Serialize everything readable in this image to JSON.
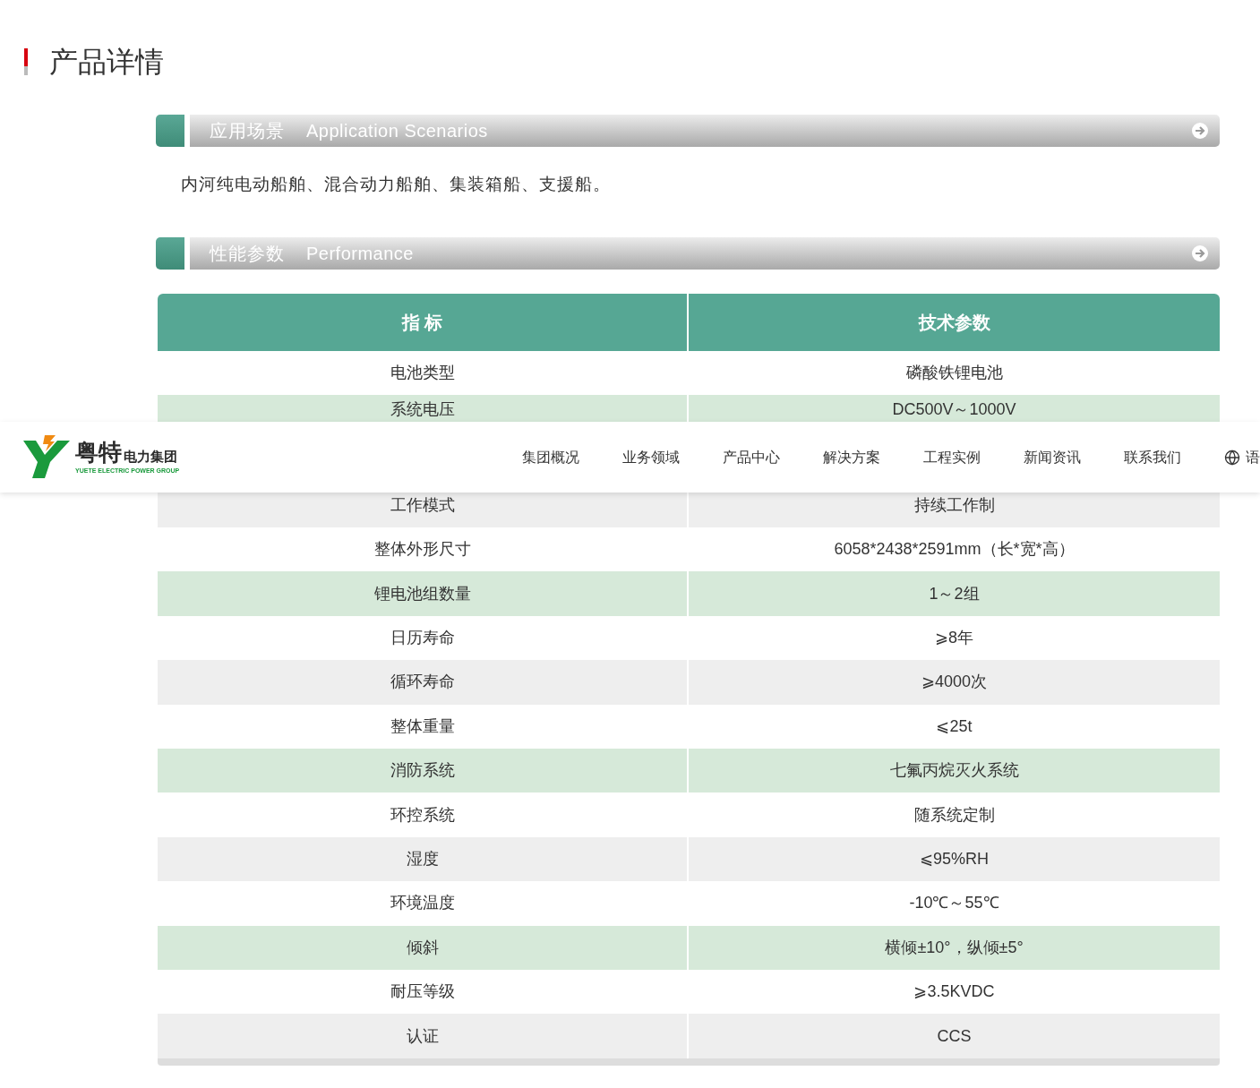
{
  "page_title": "产品详情",
  "sections": [
    {
      "title_cn": "应用场景",
      "title_en": "Application Scenarios",
      "text": "内河纯电动船舶、混合动力船舶、集装箱船、支援船。"
    },
    {
      "title_cn": "性能参数",
      "title_en": "Performance"
    }
  ],
  "table": {
    "columns": [
      "指 标",
      "技术参数"
    ],
    "rows": [
      [
        "电池类型",
        "磷酸铁锂电池"
      ],
      [
        "系统电压",
        "DC500V～1000V"
      ],
      [
        "工作模式",
        "持续工作制"
      ],
      [
        "整体外形尺寸",
        "6058*2438*2591mm（长*宽*高）"
      ],
      [
        "锂电池组数量",
        "1～2组"
      ],
      [
        "日历寿命",
        "⩾8年"
      ],
      [
        "循环寿命",
        "⩾4000次"
      ],
      [
        "整体重量",
        "⩽25t"
      ],
      [
        "消防系统",
        "七氟丙烷灭火系统"
      ],
      [
        "环控系统",
        "随系统定制"
      ],
      [
        "湿度",
        "⩽95%RH"
      ],
      [
        "环境温度",
        "-10℃～55℃"
      ],
      [
        "倾斜",
        "横倾±10°，纵倾±5°"
      ],
      [
        "耐压等级",
        "⩾3.5KVDC"
      ],
      [
        "认证",
        "CCS"
      ]
    ]
  },
  "header": {
    "logo": {
      "name": "粤特",
      "sub": "电力集团",
      "en": "YUETE ELECTRIC POWER GROUP"
    },
    "nav": [
      "集团概况",
      "业务领域",
      "产品中心",
      "解决方案",
      "工程实例",
      "新闻资讯",
      "联系我们"
    ],
    "language": "语"
  }
}
